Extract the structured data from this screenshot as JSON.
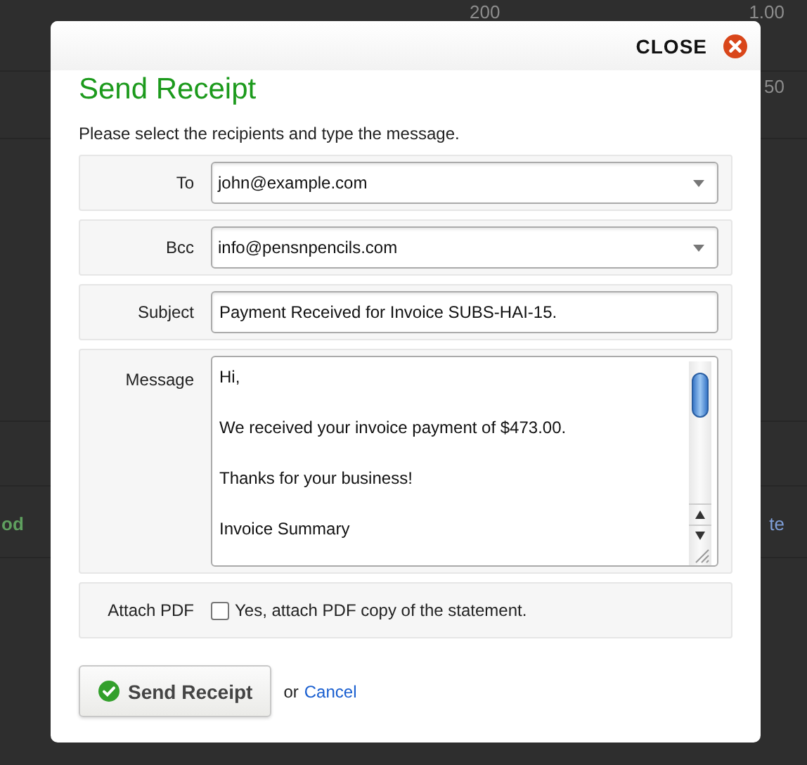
{
  "background": {
    "rows": [
      {
        "cells": [
          "200",
          "1.00"
        ]
      },
      {
        "cells": [
          "",
          "50"
        ]
      },
      {
        "cells": [
          "od",
          "te"
        ]
      }
    ]
  },
  "dialog": {
    "close_label": "CLOSE",
    "title": "Send Receipt",
    "intro": "Please select the recipients and type the message.",
    "fields": [
      {
        "kind": "select",
        "label": "To",
        "value": "john@example.com"
      },
      {
        "kind": "select",
        "label": "Bcc",
        "value": "info@pensnpencils.com"
      },
      {
        "kind": "text",
        "label": "Subject",
        "value": "Payment Received for Invoice SUBS-HAI-15."
      }
    ],
    "message": {
      "label": "Message",
      "paragraphs": [
        "Hi,",
        "We received your invoice payment of $473.00.",
        "Thanks for your business!",
        "Invoice Summary"
      ]
    },
    "attach": {
      "label": "Attach PDF",
      "option": "Yes, attach PDF copy of the statement.",
      "checked": false
    },
    "submit": "Send Receipt",
    "or": "or",
    "cancel": "Cancel"
  }
}
